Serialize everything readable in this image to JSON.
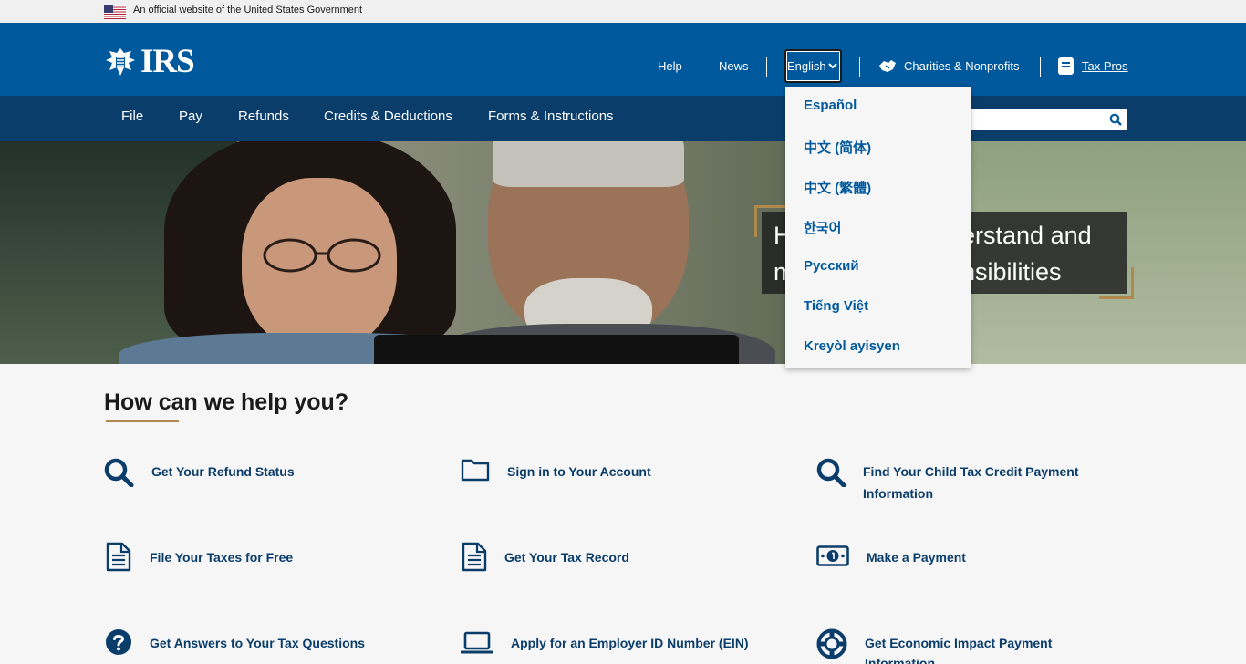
{
  "gov_banner": {
    "text": "An official website of the United States Government"
  },
  "header": {
    "logo_text": "IRS",
    "util_links": {
      "help": "Help",
      "news": "News",
      "charities": "Charities & Nonprofits",
      "tax_pros": "Tax Pros"
    },
    "language_selected": "English"
  },
  "main_nav": {
    "items": [
      "File",
      "Pay",
      "Refunds",
      "Credits & Deductions",
      "Forms & Instructions"
    ]
  },
  "hero": {
    "caption_line1": "H",
    "caption_line1_end": "derstand and",
    "caption_line2": "m",
    "caption_line2_end": "onsibilities"
  },
  "language_menu": {
    "options": [
      "Español",
      "中文 (简体)",
      "中文 (繁體)",
      "한국어",
      "Русский",
      "Tiếng Việt",
      "Kreyòl ayisyen"
    ]
  },
  "help": {
    "title": "How can we help you?",
    "items": [
      {
        "label": "Get Your Refund Status",
        "icon": "search-icon"
      },
      {
        "label": "Sign in to Your Account",
        "icon": "folder-icon"
      },
      {
        "label": "Find Your Child Tax Credit Payment",
        "label2": "Information",
        "icon": "search-icon"
      },
      {
        "label": "File Your Taxes for Free",
        "icon": "document-icon"
      },
      {
        "label": "Get Your Tax Record",
        "icon": "document-icon"
      },
      {
        "label": "Make a Payment",
        "icon": "money-icon"
      },
      {
        "label": "Get Answers to Your Tax Questions",
        "icon": "question-icon"
      },
      {
        "label": "Apply for an Employer ID Number (EIN)",
        "icon": "laptop-icon"
      },
      {
        "label": "Get Economic Impact Payment",
        "label2": "Information",
        "icon": "lifebuoy-icon"
      }
    ]
  },
  "colors": {
    "header_blue": "#00599c",
    "nav_navy": "#0b3d6b",
    "accent_gold": "#b08a4c",
    "link_blue": "#00599c"
  }
}
